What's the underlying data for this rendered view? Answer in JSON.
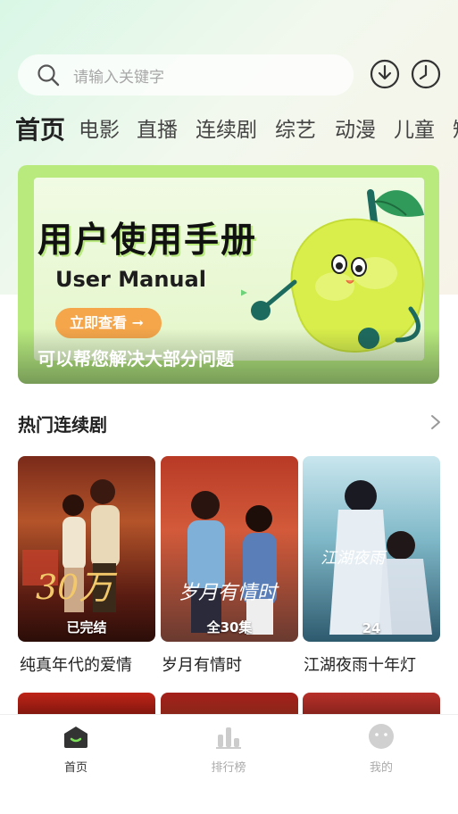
{
  "search": {
    "placeholder": "请输入关键字"
  },
  "header_icons": [
    "download-icon",
    "history-clock-icon"
  ],
  "tabs": [
    {
      "label": "首页",
      "active": true
    },
    {
      "label": "电影"
    },
    {
      "label": "直播"
    },
    {
      "label": "连续剧"
    },
    {
      "label": "综艺"
    },
    {
      "label": "动漫"
    },
    {
      "label": "儿童"
    },
    {
      "label": "短"
    }
  ],
  "banner": {
    "title": "用户使用手册",
    "subtitle": "User Manual",
    "button": "立即查看 ➞",
    "caption": "可以帮您解决大部分问题",
    "accent_color": "#b8ea7e",
    "button_color": "#f5a54a"
  },
  "section": {
    "title": "热门连续剧",
    "more_icon": "chevron-right-icon"
  },
  "cards": [
    {
      "title": "纯真年代的爱情",
      "badge": "已完结"
    },
    {
      "title": "岁月有情时",
      "badge": "全30集"
    },
    {
      "title": "江湖夜雨十年灯",
      "badge": "24"
    }
  ],
  "bottom_nav": [
    {
      "label": "首页",
      "icon": "home-icon",
      "active": true
    },
    {
      "label": "排行榜",
      "icon": "ranking-icon"
    },
    {
      "label": "我的",
      "icon": "profile-icon"
    }
  ]
}
